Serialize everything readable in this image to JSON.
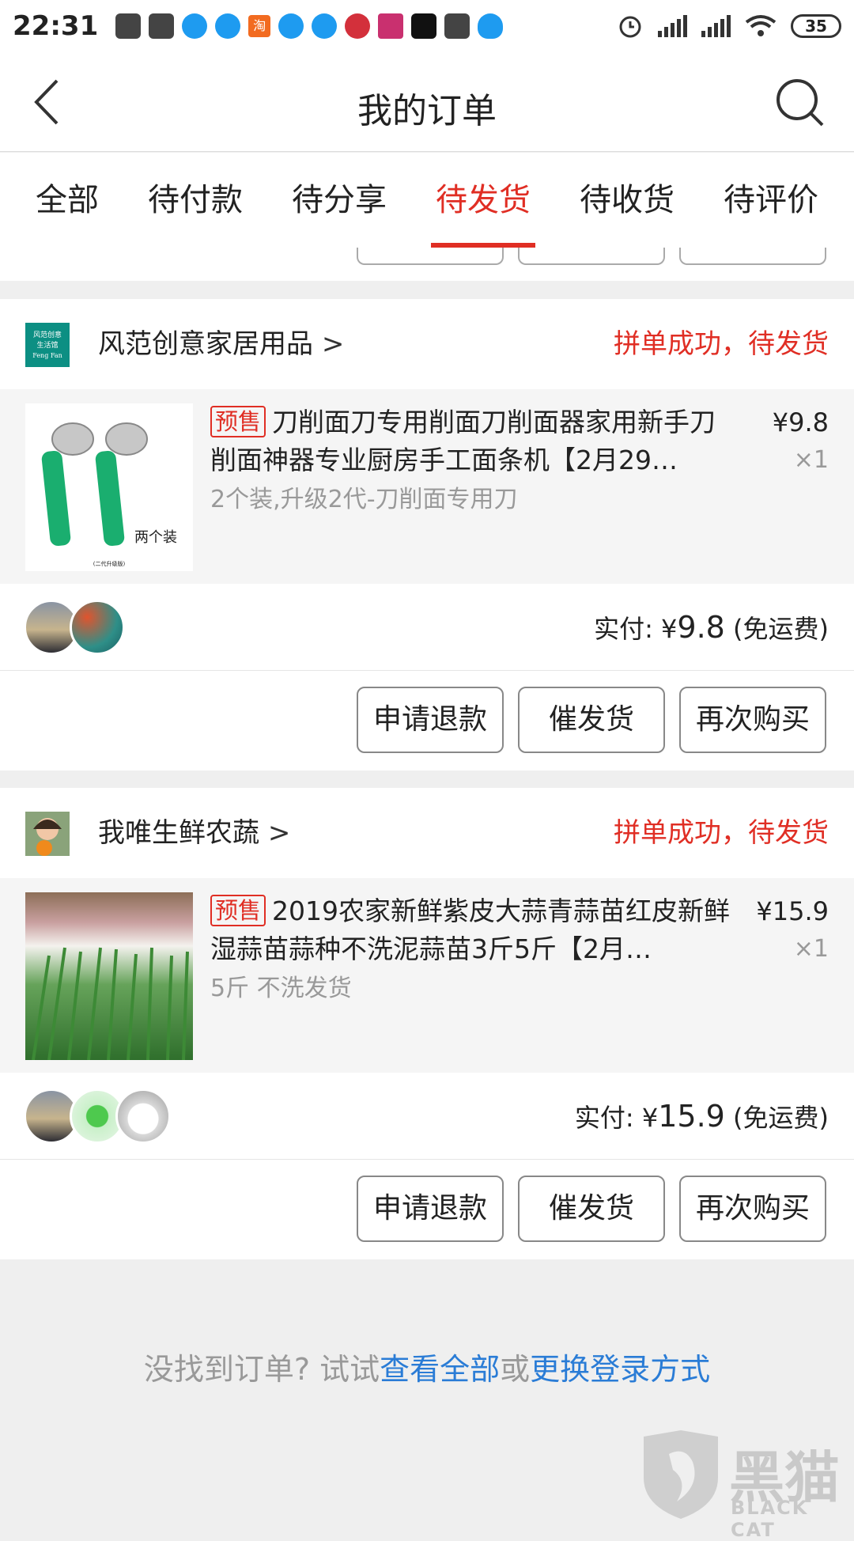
{
  "status_bar": {
    "time": "22:31",
    "battery": "35",
    "notif_icons": [
      "chat-icon",
      "horn-icon",
      "bird-icon",
      "bird-icon",
      "taobao-icon",
      "bird-icon",
      "bird-icon",
      "weibo-icon",
      "sale-app-icon",
      "tiktok-icon",
      "horn-icon",
      "qq-icon"
    ],
    "sys_icons": [
      "alarm-icon",
      "signal-icon",
      "signal-icon",
      "wifi-icon",
      "battery-icon"
    ]
  },
  "nav": {
    "title": "我的订单",
    "back_icon": "chevron-left-icon",
    "search_icon": "search-icon"
  },
  "tabs": [
    {
      "label": "全部",
      "active": false
    },
    {
      "label": "待付款",
      "active": false
    },
    {
      "label": "待分享",
      "active": false
    },
    {
      "label": "待发货",
      "active": true
    },
    {
      "label": "待收货",
      "active": false
    },
    {
      "label": "待评价",
      "active": false
    }
  ],
  "orders": [
    {
      "shop_name": "风范创意家居用品",
      "shop_logo_text": [
        "风范创意",
        "生活馆",
        "Feng Fan"
      ],
      "status": "拼单成功，待发货",
      "presale_tag": "预售",
      "title": "刀削面刀专用削面刀削面器家用新手刀削面神器专业厨房手工面条机【2月29…",
      "spec": "2个装,升级2代-刀削面专用刀",
      "price": "¥9.8",
      "qty": "×1",
      "thumb_caption": "两个装",
      "thumb_subcaption": "(二代升级版)",
      "paid_label": "实付: ",
      "paid_currency": "¥",
      "paid_amount": "9.8",
      "shipping": " (免运费)",
      "buttons": [
        "申请退款",
        "催发货",
        "再次购买"
      ]
    },
    {
      "shop_name": "我唯生鲜农蔬",
      "status": "拼单成功，待发货",
      "presale_tag": "预售",
      "title": "2019农家新鲜紫皮大蒜青蒜苗红皮新鲜湿蒜苗蒜种不洗泥蒜苗3斤5斤【2月…",
      "spec": "5斤 不洗发货",
      "price": "¥15.9",
      "qty": "×1",
      "paid_label": "实付: ",
      "paid_currency": "¥",
      "paid_amount": "15.9",
      "shipping": " (免运费)",
      "buttons": [
        "申请退款",
        "催发货",
        "再次购买"
      ]
    }
  ],
  "footer": {
    "prefix": "没找到订单? 试试",
    "link_all": "查看全部",
    "middle": "或",
    "link_login": "更换登录方式"
  },
  "watermark": {
    "cn": "黑猫",
    "en": "BLACK CAT"
  },
  "colors": {
    "accent": "#e02e24",
    "link": "#2a7cd6",
    "muted": "#999999"
  }
}
